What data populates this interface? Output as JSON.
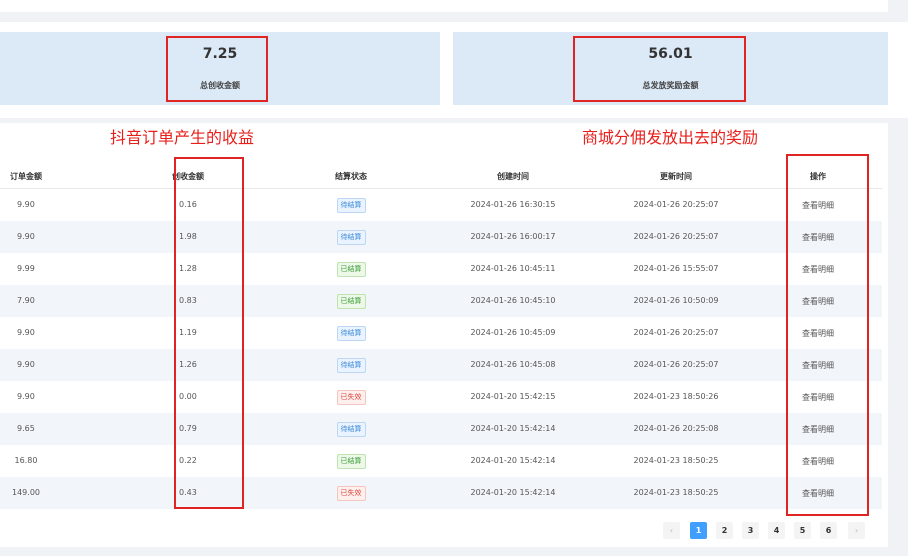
{
  "stats": {
    "cards": [
      {
        "value": "7.25",
        "label": "总创收金额"
      },
      {
        "value": "56.01",
        "label": "总发放奖励金额"
      }
    ]
  },
  "annotations": {
    "left": "抖音订单产生的收益",
    "right": "商城分佣发放出去的奖励"
  },
  "table": {
    "columns": [
      "订单金额",
      "创收金额",
      "结算状态",
      "创建时间",
      "更新时间",
      "操作"
    ],
    "action_label": "查看明细",
    "rows": [
      {
        "amount": "9.90",
        "revenue": "0.16",
        "status": "待结算",
        "status_type": "pending",
        "created": "2024-01-26 16:30:15",
        "updated": "2024-01-26 20:25:07"
      },
      {
        "amount": "9.90",
        "revenue": "1.98",
        "status": "待结算",
        "status_type": "pending",
        "created": "2024-01-26 16:00:17",
        "updated": "2024-01-26 20:25:07"
      },
      {
        "amount": "9.99",
        "revenue": "1.28",
        "status": "已结算",
        "status_type": "settled",
        "created": "2024-01-26 10:45:11",
        "updated": "2024-01-26 15:55:07"
      },
      {
        "amount": "7.90",
        "revenue": "0.83",
        "status": "已结算",
        "status_type": "settled",
        "created": "2024-01-26 10:45:10",
        "updated": "2024-01-26 10:50:09"
      },
      {
        "amount": "9.90",
        "revenue": "1.19",
        "status": "待结算",
        "status_type": "pending",
        "created": "2024-01-26 10:45:09",
        "updated": "2024-01-26 20:25:07"
      },
      {
        "amount": "9.90",
        "revenue": "1.26",
        "status": "待结算",
        "status_type": "pending",
        "created": "2024-01-26 10:45:08",
        "updated": "2024-01-26 20:25:07"
      },
      {
        "amount": "9.90",
        "revenue": "0.00",
        "status": "已失效",
        "status_type": "failed",
        "created": "2024-01-20 15:42:15",
        "updated": "2024-01-23 18:50:26"
      },
      {
        "amount": "9.65",
        "revenue": "0.79",
        "status": "待结算",
        "status_type": "pending",
        "created": "2024-01-20 15:42:14",
        "updated": "2024-01-26 20:25:08"
      },
      {
        "amount": "16.80",
        "revenue": "0.22",
        "status": "已结算",
        "status_type": "settled",
        "created": "2024-01-20 15:42:14",
        "updated": "2024-01-23 18:50:25"
      },
      {
        "amount": "149.00",
        "revenue": "0.43",
        "status": "已失效",
        "status_type": "failed",
        "created": "2024-01-20 15:42:14",
        "updated": "2024-01-23 18:50:25"
      }
    ]
  },
  "pagination": {
    "prev": "‹",
    "next": "›",
    "pages": [
      "1",
      "2",
      "3",
      "4",
      "5",
      "6"
    ],
    "current": "1"
  },
  "colors": {
    "annotation": "#e8201c",
    "highlight_box": "#e02424",
    "accent": "#409eff",
    "card_bg": "#dce9f7"
  }
}
